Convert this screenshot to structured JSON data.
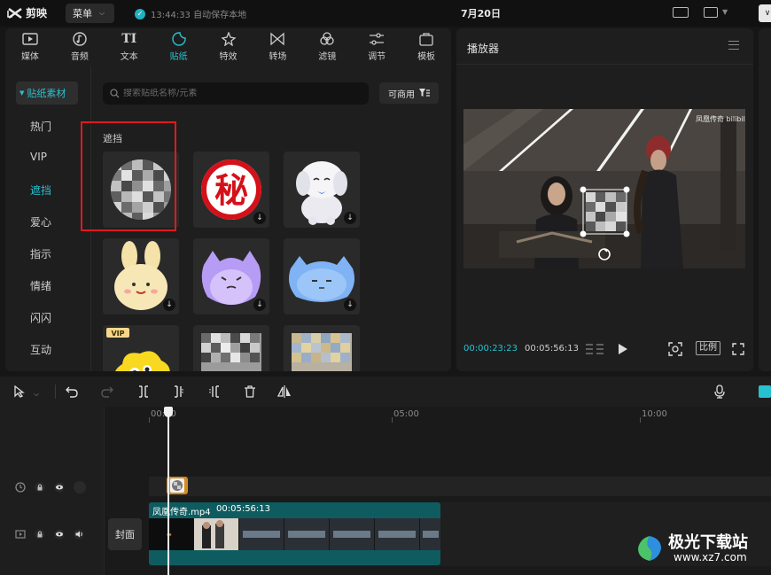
{
  "app": {
    "logo_text": "剪映",
    "menu_label": "菜单",
    "autosave": "13:44:33 自动保存本地",
    "project_title": "7月20日"
  },
  "tabs": [
    {
      "label": "媒体",
      "icon": "media-icon"
    },
    {
      "label": "音频",
      "icon": "audio-icon"
    },
    {
      "label": "文本",
      "icon": "text-icon"
    },
    {
      "label": "贴纸",
      "icon": "sticker-icon",
      "active": true
    },
    {
      "label": "特效",
      "icon": "effects-icon"
    },
    {
      "label": "转场",
      "icon": "transition-icon"
    },
    {
      "label": "滤镜",
      "icon": "filter-icon"
    },
    {
      "label": "调节",
      "icon": "adjust-icon"
    },
    {
      "label": "模板",
      "icon": "template-icon"
    }
  ],
  "sidebar": {
    "header": "贴纸素材",
    "items": [
      "热门",
      "VIP",
      "遮挡",
      "爱心",
      "指示",
      "情绪",
      "闪闪",
      "互动"
    ],
    "active": "遮挡"
  },
  "search": {
    "placeholder": "搜索贴纸名称/元素"
  },
  "commercial_label": "可商用",
  "section_title": "遮挡",
  "stickers": [
    {
      "name": "mosaic-circle"
    },
    {
      "name": "secret-stamp",
      "text": "秘"
    },
    {
      "name": "white-puppy"
    },
    {
      "name": "bunny-blob"
    },
    {
      "name": "purple-blob"
    },
    {
      "name": "blue-blob"
    },
    {
      "name": "vip-fluffy",
      "badge": "VIP"
    },
    {
      "name": "mosaic-gray"
    },
    {
      "name": "mosaic-color"
    }
  ],
  "player": {
    "title": "播放器",
    "current_time": "00:00:23:23",
    "total_time": "00:05:56:13",
    "ratio_label": "比例",
    "video_watermark": "凤凰传奇 bilibili"
  },
  "timeline": {
    "ruler_labels": [
      "00:00",
      "05:00",
      "10:00"
    ],
    "clip_name": "凤凰传奇.mp4",
    "clip_duration": "00:05:56:13",
    "cover_label": "封面"
  },
  "watermark": {
    "line1": "极光下载站",
    "line2": "www.xz7.com"
  },
  "colors": {
    "accent": "#27c2d2",
    "highlight_box": "#e0191f",
    "clip": "#0f5c60"
  }
}
